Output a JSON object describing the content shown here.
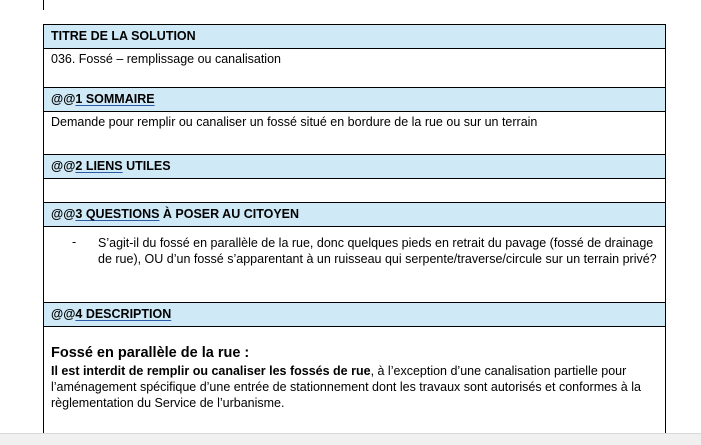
{
  "document": {
    "title_header": "TITRE DE LA SOLUTION",
    "title_value": "036. Fossé – remplissage ou canalisation",
    "sections": [
      {
        "prefix": "@@",
        "link": "1  SOMMAIRE",
        "suffix": "",
        "content": "Demande pour remplir ou canaliser un fossé situé en bordure de la rue ou sur un terrain"
      },
      {
        "prefix": "@@",
        "link": "2  LIENS",
        "suffix": " UTILES",
        "content": ""
      },
      {
        "prefix": "@@",
        "link": "3  QUESTIONS",
        "suffix": " À POSER AU CITOYEN",
        "bullet_dash": "-",
        "bullet": "S’agit-il du fossé en parallèle de la rue, donc quelques pieds en retrait du pavage (fossé de drainage de rue), OU d’un fossé s’apparentant à un ruisseau qui serpente/traverse/circule sur un terrain privé?"
      },
      {
        "prefix": "@@",
        "link": "4  DESCRIPTION",
        "suffix": "",
        "heading": "Fossé en parallèle de la rue :",
        "body_bold": "Il est interdit de remplir ou canaliser les fossés de rue",
        "body_rest": ", à l’exception d’une canalisation partielle pour l’aménagement spécifique d’une entrée de stationnement dont les travaux sont autorisés et conformes à la règlementation du Service de l’urbanisme."
      }
    ]
  }
}
